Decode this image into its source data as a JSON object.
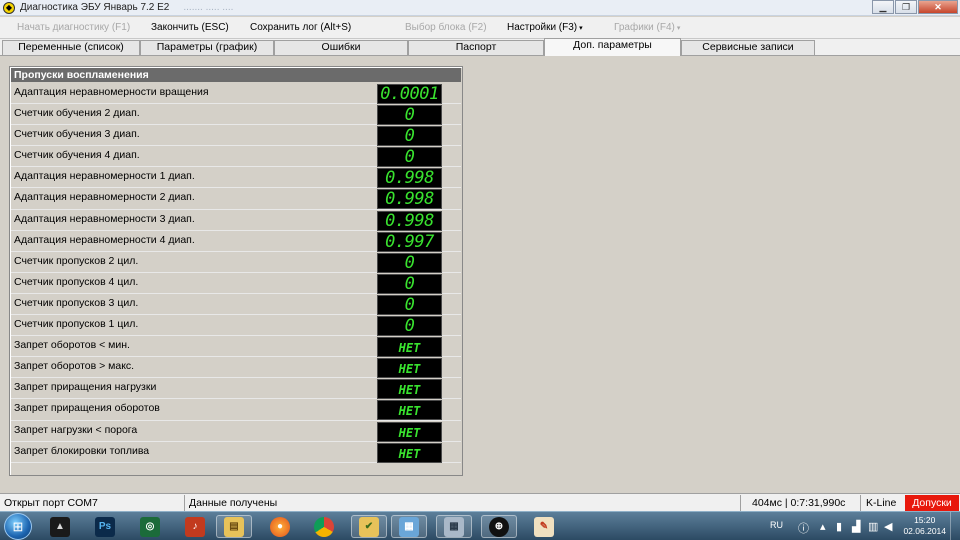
{
  "window": {
    "title": "Диагностика ЭБУ Январь 7.2 Е2",
    "title_ghost": "....... ..... ...."
  },
  "menu": {
    "items": [
      {
        "label": "Начать диагностику (F1)",
        "disabled": true
      },
      {
        "label": "Закончить (ESC)",
        "disabled": false
      },
      {
        "label": "Сохранить лог (Alt+S)",
        "disabled": false
      },
      {
        "label": "Выбор блока (F2)",
        "disabled": true
      },
      {
        "label": "Настройки (F3)",
        "disabled": false
      },
      {
        "label": "Графики (F4)",
        "disabled": true
      }
    ],
    "caret": "▾"
  },
  "tabs": [
    {
      "label": "Переменные (список)"
    },
    {
      "label": "Параметры (график)"
    },
    {
      "label": "Ошибки"
    },
    {
      "label": "Паспорт"
    },
    {
      "label": "Доп. параметры",
      "active": true
    },
    {
      "label": "Сервисные записи"
    }
  ],
  "panel": {
    "header": "Пропуски воспламенения",
    "rows": [
      {
        "label": "Адаптация неравномерности вращения",
        "value": "0.0001"
      },
      {
        "label": "Счетчик обучения 2 диап.",
        "value": "0"
      },
      {
        "label": "Счетчик обучения 3 диап.",
        "value": "0"
      },
      {
        "label": "Счетчик обучения 4 диап.",
        "value": "0"
      },
      {
        "label": "Адаптация неравномерности 1 диап.",
        "value": "0.998"
      },
      {
        "label": "Адаптация неравномерности 2 диап.",
        "value": "0.998"
      },
      {
        "label": "Адаптация неравномерности 3 диап.",
        "value": "0.998"
      },
      {
        "label": "Адаптация неравномерности 4 диап.",
        "value": "0.997"
      },
      {
        "label": "Счетчик пропусков 2 цил.",
        "value": "0"
      },
      {
        "label": "Счетчик пропусков 4 цил.",
        "value": "0"
      },
      {
        "label": "Счетчик пропусков 3 цил.",
        "value": "0"
      },
      {
        "label": "Счетчик пропусков 1 цил.",
        "value": "0"
      },
      {
        "label": "Запрет оборотов < мин.",
        "value": "НЕТ"
      },
      {
        "label": "Запрет оборотов > макс.",
        "value": "НЕТ"
      },
      {
        "label": "Запрет приращения нагрузки",
        "value": "НЕТ"
      },
      {
        "label": "Запрет приращения оборотов",
        "value": "НЕТ"
      },
      {
        "label": "Запрет нагрузки < порога",
        "value": "НЕТ"
      },
      {
        "label": "Запрет блокировки топлива",
        "value": "НЕТ"
      }
    ]
  },
  "status": {
    "port": "Открыт порт COM7",
    "data": "Данные получены",
    "timing": "404мс | 0:7:31,990с",
    "protocol": "K-Line",
    "admit": "Допуски"
  },
  "taskbar": {
    "pinned_icons": [
      "artcam-icon",
      "photoshop-icon",
      "app-icon",
      "media-icon",
      "folder-icon",
      "firefox-icon",
      "chrome-icon",
      "files-icon",
      "image-viewer-icon",
      "calculator-icon",
      "diagnostic-app-icon",
      "paint-icon"
    ],
    "photoshop_glyph": "Ps",
    "tray_lang": "RU",
    "clock_time": "15:20",
    "clock_date": "02.06.2014"
  },
  "colors": {
    "accent": "#39e32f",
    "admit": "#e8180c"
  }
}
